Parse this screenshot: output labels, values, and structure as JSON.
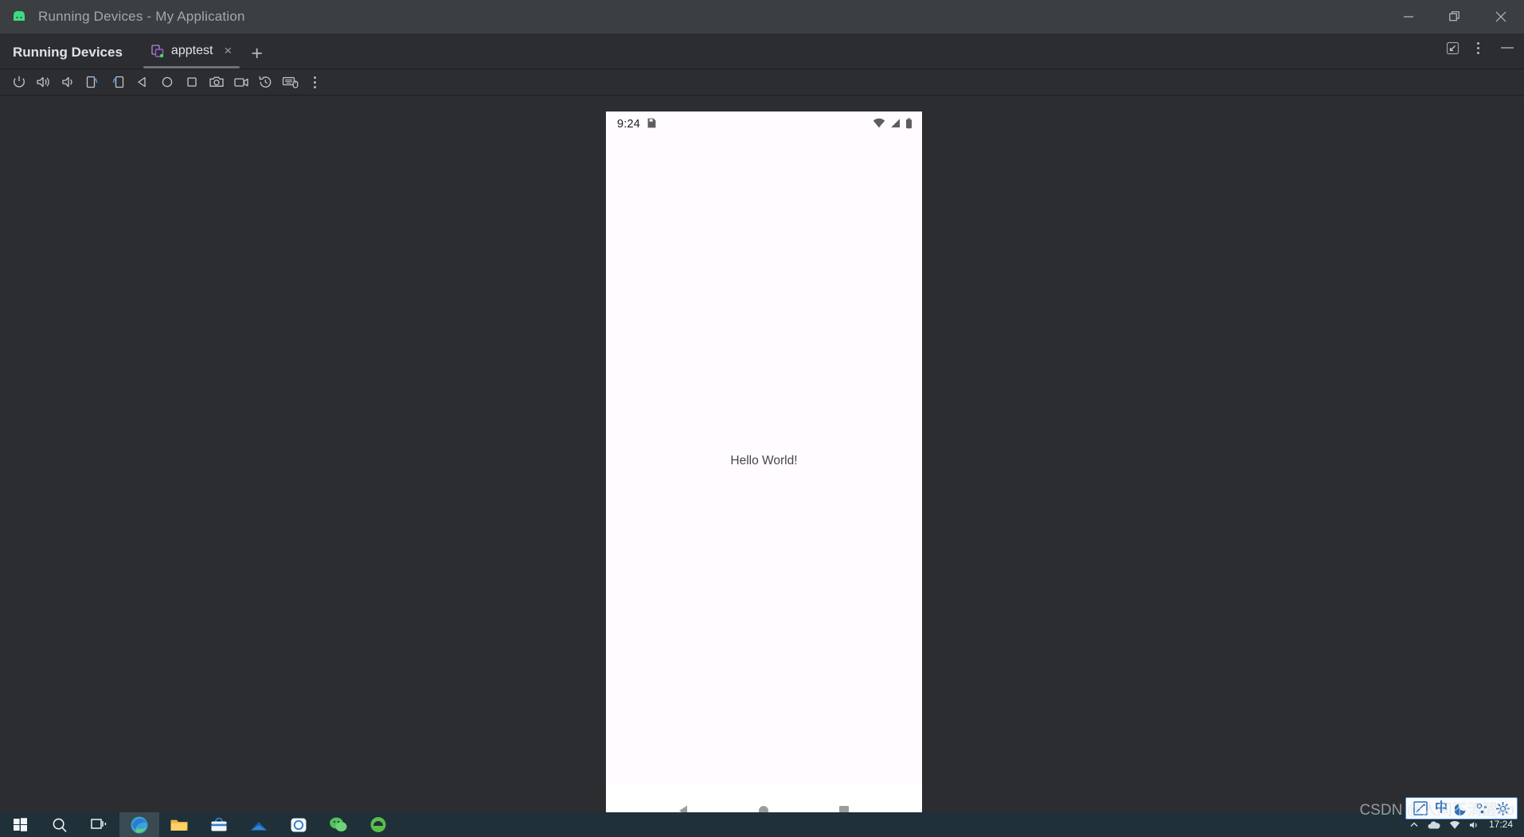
{
  "window": {
    "title": "Running Devices - My Application",
    "app_icon": "android-icon",
    "controls": {
      "minimize": "minimize-icon",
      "restore": "restore-icon",
      "close": "close-icon"
    }
  },
  "tool_window": {
    "panel_title": "Running Devices",
    "tabs": [
      {
        "label": "apptest",
        "icon": "device-icon",
        "close_label": "×",
        "active": true
      }
    ],
    "add_tab_label": "+",
    "header_actions": [
      {
        "name": "collapse-icon",
        "title": "Minimize"
      },
      {
        "name": "more-options-icon",
        "title": "Options"
      },
      {
        "name": "hide-icon",
        "title": "Hide"
      }
    ]
  },
  "device_toolbar": {
    "buttons": [
      {
        "name": "power-button-icon",
        "label": "Power"
      },
      {
        "name": "volume-up-icon",
        "label": "Volume Up"
      },
      {
        "name": "volume-down-icon",
        "label": "Volume Down"
      },
      {
        "name": "rotate-left-icon",
        "label": "Rotate Left"
      },
      {
        "name": "rotate-right-icon",
        "label": "Rotate Right"
      },
      {
        "name": "back-button-icon",
        "label": "Back"
      },
      {
        "name": "home-button-icon",
        "label": "Home"
      },
      {
        "name": "overview-button-icon",
        "label": "Overview"
      },
      {
        "name": "screenshot-icon",
        "label": "Take Screenshot"
      },
      {
        "name": "screen-record-icon",
        "label": "Record Screen"
      },
      {
        "name": "back-in-time-icon",
        "label": "Back In Time"
      },
      {
        "name": "hardware-input-icon",
        "label": "Hardware Input"
      },
      {
        "name": "more-actions-icon",
        "label": "More"
      }
    ]
  },
  "device": {
    "status_bar": {
      "time": "9:24",
      "left_icons": [
        "sd-card-icon"
      ],
      "right_icons": [
        "wifi-off-icon",
        "signal-icon",
        "battery-icon"
      ]
    },
    "app": {
      "text": "Hello World!"
    },
    "nav_bar": {
      "buttons": [
        {
          "name": "nav-back-icon",
          "label": "Back"
        },
        {
          "name": "nav-home-icon",
          "label": "Home"
        },
        {
          "name": "nav-recents-icon",
          "label": "Recents"
        }
      ]
    }
  },
  "taskbar": {
    "apps": [
      {
        "name": "taskbar-start-icon",
        "label": "Start"
      },
      {
        "name": "taskbar-search-icon",
        "label": "Search"
      },
      {
        "name": "taskbar-taskview-icon",
        "label": "Task View"
      },
      {
        "name": "taskbar-edge-icon",
        "label": "Microsoft Edge",
        "active": true
      },
      {
        "name": "taskbar-explorer-icon",
        "label": "File Explorer"
      },
      {
        "name": "taskbar-store-icon",
        "label": "Microsoft Store"
      },
      {
        "name": "taskbar-mail-icon",
        "label": "Mail"
      },
      {
        "name": "taskbar-settings-icon",
        "label": "Settings"
      },
      {
        "name": "taskbar-wechat-icon",
        "label": "WeChat"
      },
      {
        "name": "taskbar-android-studio-icon",
        "label": "Android Studio"
      }
    ],
    "tray": {
      "time": "17:24",
      "ime": {
        "pen_icon": "ime-pen-icon",
        "mode": "中",
        "moon_icon": "ime-moon-icon",
        "emoji_icon": "ime-tools-icon",
        "settings_icon": "ime-settings-icon"
      }
    }
  },
  "watermark": {
    "text": "CSDN @人间不清醒ab"
  },
  "colors": {
    "window_chrome": "#3c3f41",
    "panel_bg": "#2b2d30",
    "accent_blue": "#4a90d9",
    "device_screen": "#FFFBFF",
    "taskbar": "#1f3038"
  }
}
